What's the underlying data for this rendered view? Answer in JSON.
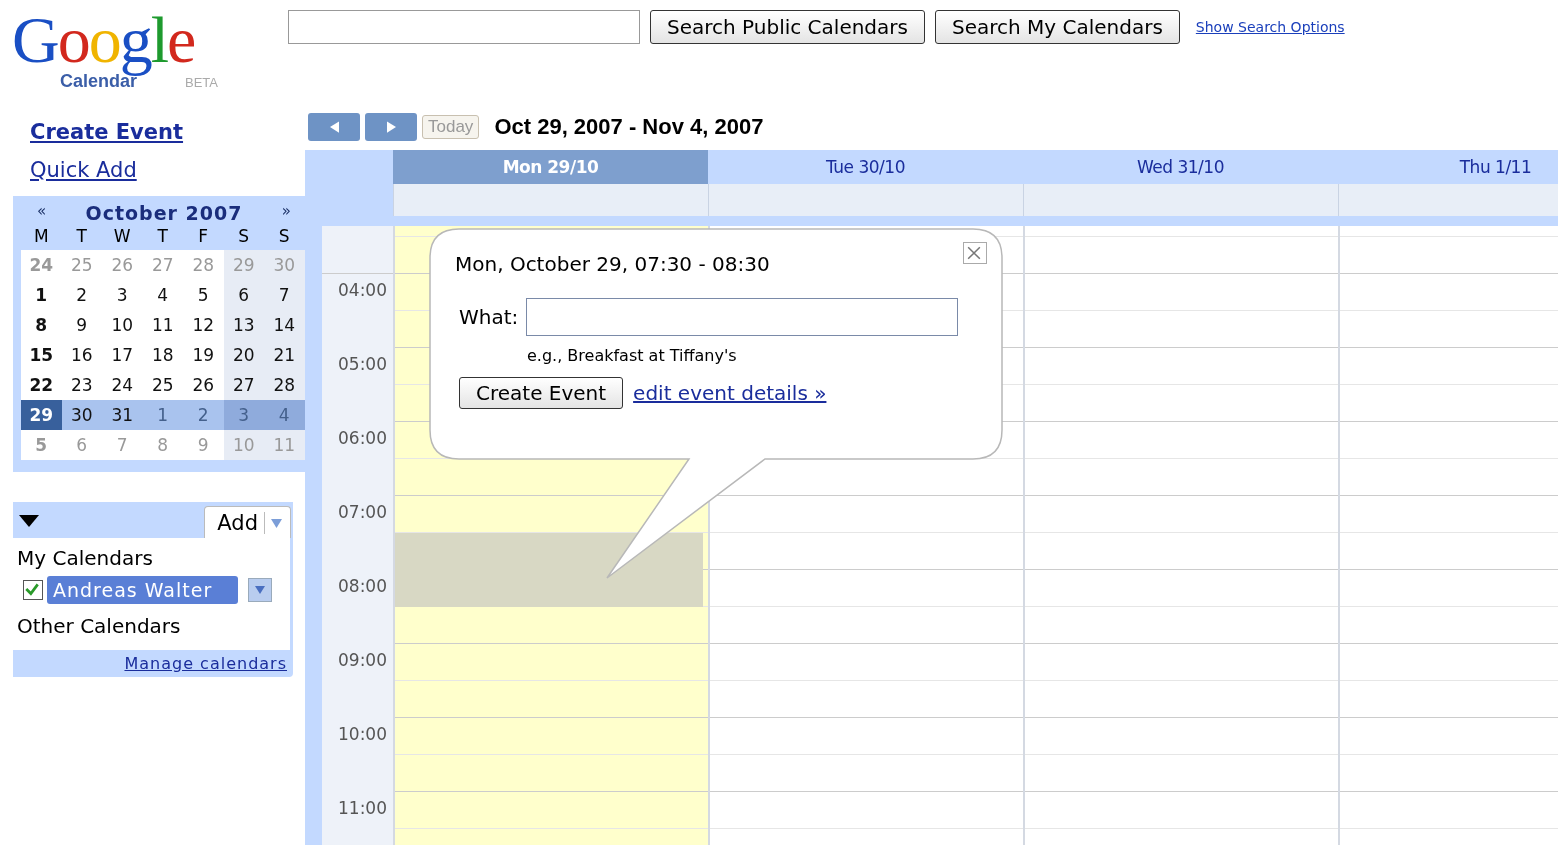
{
  "logo": {
    "wordmark": "Google",
    "product": "Calendar",
    "badge": "BETA"
  },
  "search": {
    "buttons": [
      "Search Public Calendars",
      "Search My Calendars"
    ],
    "options_link": "Show Search Options"
  },
  "sidebar": {
    "links": [
      "Create Event",
      "Quick Add"
    ]
  },
  "mini_calendar": {
    "prev": "«",
    "title": "October 2007",
    "next": "»",
    "weekdays": [
      "M",
      "T",
      "W",
      "T",
      "F",
      "S",
      "S"
    ],
    "weeks": [
      {
        "selected": false,
        "days": [
          {
            "label": "24",
            "other_month": true,
            "today": false
          },
          {
            "label": "25",
            "other_month": true,
            "today": false
          },
          {
            "label": "26",
            "other_month": true,
            "today": false
          },
          {
            "label": "27",
            "other_month": true,
            "today": false
          },
          {
            "label": "28",
            "other_month": true,
            "today": false
          },
          {
            "label": "29",
            "other_month": true,
            "today": false
          },
          {
            "label": "30",
            "other_month": true,
            "today": false
          }
        ]
      },
      {
        "selected": false,
        "days": [
          {
            "label": "1",
            "other_month": false,
            "today": false
          },
          {
            "label": "2",
            "other_month": false,
            "today": false
          },
          {
            "label": "3",
            "other_month": false,
            "today": false
          },
          {
            "label": "4",
            "other_month": false,
            "today": false
          },
          {
            "label": "5",
            "other_month": false,
            "today": false
          },
          {
            "label": "6",
            "other_month": false,
            "today": false
          },
          {
            "label": "7",
            "other_month": false,
            "today": false
          }
        ]
      },
      {
        "selected": false,
        "days": [
          {
            "label": "8",
            "other_month": false,
            "today": false
          },
          {
            "label": "9",
            "other_month": false,
            "today": false
          },
          {
            "label": "10",
            "other_month": false,
            "today": false
          },
          {
            "label": "11",
            "other_month": false,
            "today": false
          },
          {
            "label": "12",
            "other_month": false,
            "today": false
          },
          {
            "label": "13",
            "other_month": false,
            "today": false
          },
          {
            "label": "14",
            "other_month": false,
            "today": false
          }
        ]
      },
      {
        "selected": false,
        "days": [
          {
            "label": "15",
            "other_month": false,
            "today": false
          },
          {
            "label": "16",
            "other_month": false,
            "today": false
          },
          {
            "label": "17",
            "other_month": false,
            "today": false
          },
          {
            "label": "18",
            "other_month": false,
            "today": false
          },
          {
            "label": "19",
            "other_month": false,
            "today": false
          },
          {
            "label": "20",
            "other_month": false,
            "today": false
          },
          {
            "label": "21",
            "other_month": false,
            "today": false
          }
        ]
      },
      {
        "selected": false,
        "days": [
          {
            "label": "22",
            "other_month": false,
            "today": false
          },
          {
            "label": "23",
            "other_month": false,
            "today": false
          },
          {
            "label": "24",
            "other_month": false,
            "today": false
          },
          {
            "label": "25",
            "other_month": false,
            "today": false
          },
          {
            "label": "26",
            "other_month": false,
            "today": false
          },
          {
            "label": "27",
            "other_month": false,
            "today": false
          },
          {
            "label": "28",
            "other_month": false,
            "today": false
          }
        ]
      },
      {
        "selected": true,
        "days": [
          {
            "label": "29",
            "other_month": false,
            "today": true
          },
          {
            "label": "30",
            "other_month": false,
            "today": false
          },
          {
            "label": "31",
            "other_month": false,
            "today": false
          },
          {
            "label": "1",
            "other_month": true,
            "today": false
          },
          {
            "label": "2",
            "other_month": true,
            "today": false
          },
          {
            "label": "3",
            "other_month": true,
            "today": false
          },
          {
            "label": "4",
            "other_month": true,
            "today": false
          }
        ]
      },
      {
        "selected": false,
        "days": [
          {
            "label": "5",
            "other_month": true,
            "today": false
          },
          {
            "label": "6",
            "other_month": true,
            "today": false
          },
          {
            "label": "7",
            "other_month": true,
            "today": false
          },
          {
            "label": "8",
            "other_month": true,
            "today": false
          },
          {
            "label": "9",
            "other_month": true,
            "today": false
          },
          {
            "label": "10",
            "other_month": true,
            "today": false
          },
          {
            "label": "11",
            "other_month": true,
            "today": false
          }
        ]
      }
    ]
  },
  "calendars": {
    "add_button": "Add",
    "my_heading": "My Calendars",
    "my": [
      {
        "name": "Andreas Walter",
        "checked": true,
        "color": "#5a7fd6"
      }
    ],
    "other_heading": "Other Calendars",
    "manage_link": "Manage calendars"
  },
  "toolbar": {
    "today_button": "Today",
    "range": "Oct 29, 2007 - Nov 4, 2007"
  },
  "days": [
    {
      "label": "Mon 29/10",
      "selected": true
    },
    {
      "label": "Tue 30/10",
      "selected": false
    },
    {
      "label": "Wed 31/10",
      "selected": false
    },
    {
      "label": "Thu 1/11",
      "selected": false
    }
  ],
  "hours": [
    "04:00",
    "05:00",
    "06:00",
    "07:00",
    "08:00",
    "09:00",
    "10:00",
    "11:00"
  ],
  "popup": {
    "title": "Mon, October 29, 07:30 - 08:30",
    "what_label": "What:",
    "hint": "e.g., Breakfast at Tiffany's",
    "create_button": "Create Event",
    "details_link": "edit event details »"
  }
}
